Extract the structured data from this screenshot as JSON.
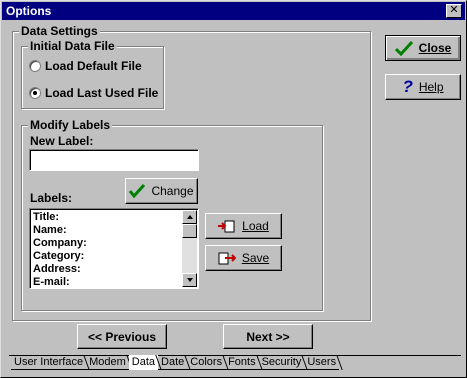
{
  "window": {
    "title": "Options"
  },
  "data_settings": {
    "title": "Data Settings",
    "initial_data_file": {
      "title": "Initial Data File",
      "options": [
        {
          "label": "Load Default File",
          "selected": false
        },
        {
          "label": "Load Last Used File",
          "selected": true
        }
      ]
    },
    "modify_labels": {
      "title": "Modify Labels",
      "new_label_caption": "New Label:",
      "new_label_value": "",
      "labels_caption": "Labels:",
      "change_label": "Change",
      "load_label": "Load",
      "save_label": "Save",
      "items": [
        "Title:",
        "Name:",
        "Company:",
        "Category:",
        "Address:",
        "E-mail:"
      ]
    }
  },
  "side_buttons": {
    "close_label": "Close",
    "help_label": "Help"
  },
  "nav": {
    "previous_label": "<< Previous",
    "next_label": "Next >>"
  },
  "tabs": [
    "User Interface",
    "Modem",
    "Data",
    "Date",
    "Colors",
    "Fonts",
    "Security",
    "Users"
  ],
  "active_tab": "Data",
  "colors": {
    "titlebar": "#000080",
    "face": "#c0c0c0",
    "check": "#008000"
  }
}
